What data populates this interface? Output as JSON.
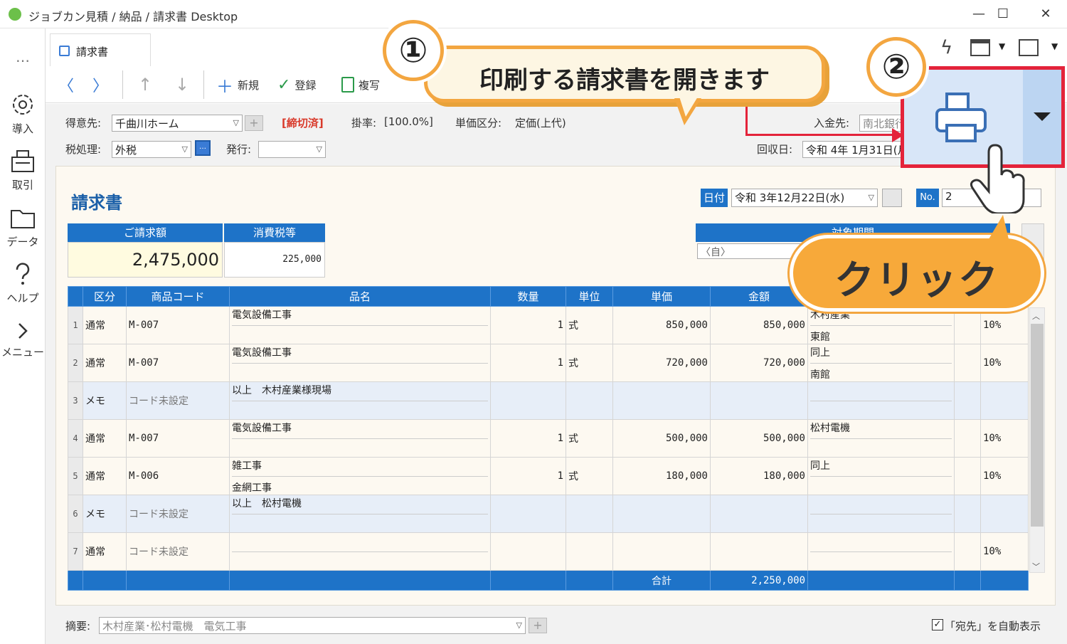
{
  "window": {
    "title": "ジョブカン見積 / 納品 / 請求書 Desktop",
    "minimize": "—",
    "maximize": "☐",
    "close": "✕"
  },
  "sidebar": {
    "more": "…",
    "items": [
      {
        "label": "導入",
        "icon": "gear-icon"
      },
      {
        "label": "取引",
        "icon": "register-icon"
      },
      {
        "label": "データ",
        "icon": "folder-icon"
      },
      {
        "label": "ヘルプ",
        "icon": "help-icon"
      },
      {
        "label": "メニュー",
        "icon": "chevron-right-icon"
      }
    ]
  },
  "tab": {
    "label": "請求書"
  },
  "toolbar": {
    "back": "〈",
    "forward": "〉",
    "up": "↑",
    "down": "↓",
    "new_label": "新規",
    "register_label": "登録",
    "copy_label": "複写"
  },
  "form": {
    "customer_label": "得意先:",
    "customer_value": "千曲川ホーム",
    "closed_badge": "[締切済]",
    "rate_label": "掛率:",
    "rate_value": "[100.0%]",
    "price_type_label": "単価区分:",
    "price_type_value": "定価(上代)",
    "payment_dest_label": "入金先:",
    "payment_dest_value": "南北銀行",
    "tax_label": "税処理:",
    "tax_value": "外税",
    "issue_label": "発行:",
    "issue_value": "",
    "collect_label": "回収日:",
    "collect_value": "令和 4年 1月31日(月)"
  },
  "doc": {
    "title": "請求書",
    "date_label": "日付",
    "date_value": "令和 3年12月22日(水)",
    "no_label": "No.",
    "no_value": "2",
    "billing_label": "ご請求額",
    "billing_value": "2,475,000",
    "tax_amount_label": "消費税等",
    "tax_amount_value": "225,000",
    "period_label": "対象期間",
    "period_from": "〈自〉"
  },
  "table": {
    "headers": [
      "",
      "区分",
      "商品コード",
      "品名",
      "数量",
      "単位",
      "単価",
      "金額",
      "",
      "",
      ""
    ],
    "rows": [
      {
        "idx": "1",
        "kind": "通常",
        "code": "M-007",
        "name1": "電気設備工事",
        "name2": "",
        "qty": "1",
        "unit": "式",
        "price": "850,000",
        "amount": "850,000",
        "note1": "木村産業",
        "note2": "東館",
        "tax": "10%",
        "memo": false
      },
      {
        "idx": "2",
        "kind": "通常",
        "code": "M-007",
        "name1": "電気設備工事",
        "name2": "",
        "qty": "1",
        "unit": "式",
        "price": "720,000",
        "amount": "720,000",
        "note1": "同上",
        "note2": "南館",
        "tax": "10%",
        "memo": false
      },
      {
        "idx": "3",
        "kind": "メモ",
        "code": "コード未設定",
        "name1": "以上　木村産業様現場",
        "name2": "",
        "qty": "",
        "unit": "",
        "price": "",
        "amount": "",
        "note1": "",
        "note2": "",
        "tax": "",
        "memo": true
      },
      {
        "idx": "4",
        "kind": "通常",
        "code": "M-007",
        "name1": "電気設備工事",
        "name2": "",
        "qty": "1",
        "unit": "式",
        "price": "500,000",
        "amount": "500,000",
        "note1": "松村電機",
        "note2": "",
        "tax": "10%",
        "memo": false
      },
      {
        "idx": "5",
        "kind": "通常",
        "code": "M-006",
        "name1": "雑工事",
        "name2": "金網工事",
        "qty": "1",
        "unit": "式",
        "price": "180,000",
        "amount": "180,000",
        "note1": "同上",
        "note2": "",
        "tax": "10%",
        "memo": false
      },
      {
        "idx": "6",
        "kind": "メモ",
        "code": "コード未設定",
        "name1": "以上　松村電機",
        "name2": "",
        "qty": "",
        "unit": "",
        "price": "",
        "amount": "",
        "note1": "",
        "note2": "",
        "tax": "",
        "memo": true
      },
      {
        "idx": "7",
        "kind": "通常",
        "code": "コード未設定",
        "name1": "",
        "name2": "",
        "qty": "",
        "unit": "",
        "price": "",
        "amount": "",
        "note1": "",
        "note2": "",
        "tax": "10%",
        "memo": false
      }
    ],
    "total_label": "合計",
    "total_value": "2,250,000"
  },
  "footer": {
    "summary_label": "摘要:",
    "summary_value": "木村産業･松村電機　電気工事",
    "auto_show_label": "「宛先」を自動表示"
  },
  "annotations": {
    "step1_number": "①",
    "step1_text": "印刷する請求書を開きます",
    "step2_number": "②",
    "click_text": "クリック"
  },
  "colors": {
    "accent": "#1e73c8",
    "callout_border": "#f3a640",
    "highlight": "#e4233a",
    "closed": "#d93a2b"
  }
}
